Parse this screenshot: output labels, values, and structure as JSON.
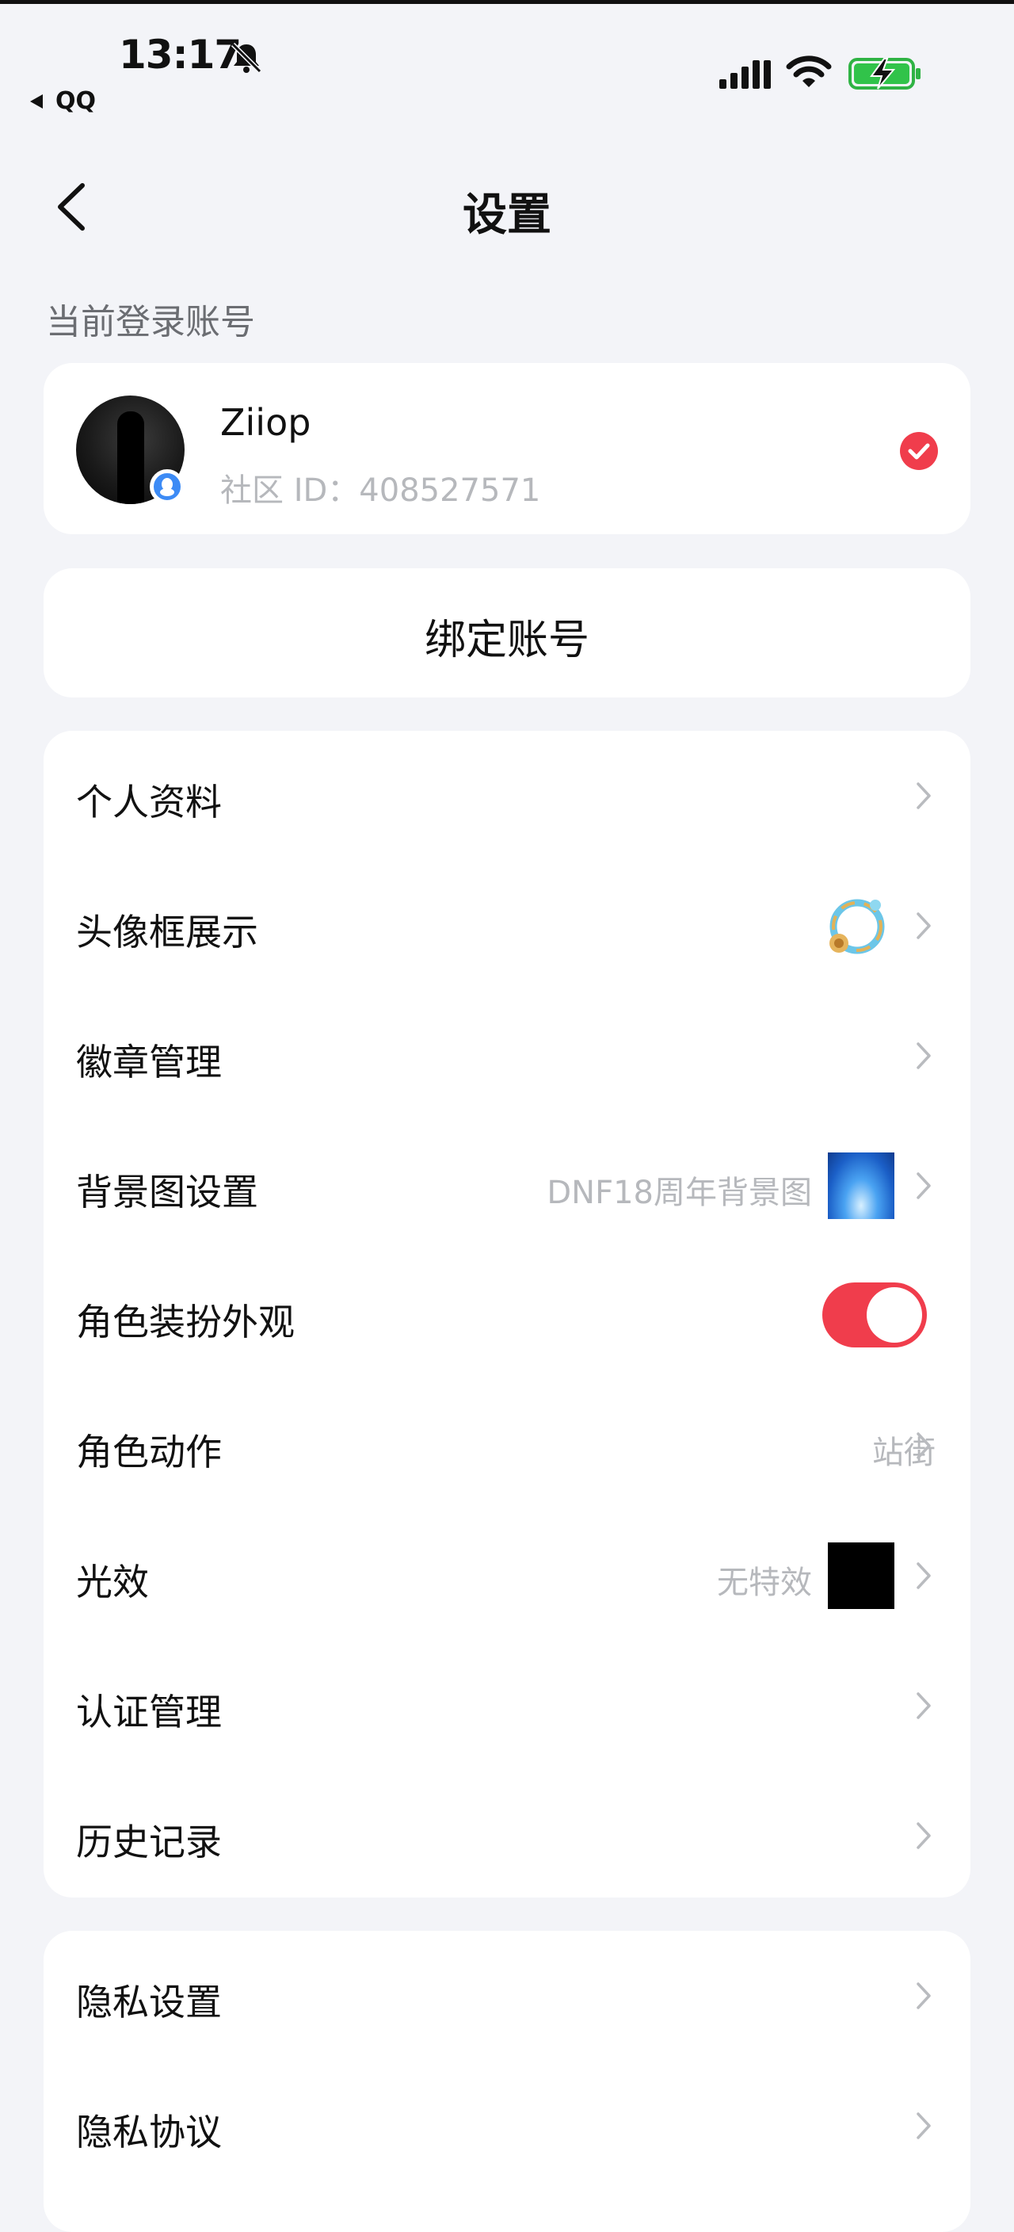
{
  "status_bar": {
    "time": "13:17",
    "back_app": "QQ",
    "icons": [
      "bell-slash-icon",
      "signal-icon",
      "wifi-icon",
      "battery-charging-icon"
    ]
  },
  "nav": {
    "title": "设置"
  },
  "account_section": {
    "label": "当前登录账号",
    "name": "Ziiop",
    "community_id": "社区 ID：408527571"
  },
  "bind_button": "绑定账号",
  "menu_group_1": [
    {
      "label": "个人资料"
    },
    {
      "label": "头像框展示"
    },
    {
      "label": "徽章管理"
    },
    {
      "label": "背景图设置",
      "value": "DNF18周年背景图"
    },
    {
      "label": "角色装扮外观",
      "toggle_on": true
    },
    {
      "label": "角色动作",
      "value": "站街"
    },
    {
      "label": "光效",
      "value": "无特效"
    },
    {
      "label": "认证管理"
    },
    {
      "label": "历史记录"
    }
  ],
  "menu_group_2": [
    {
      "label": "隐私设置"
    },
    {
      "label": "隐私协议"
    }
  ],
  "colors": {
    "background": "#f3f4f8",
    "accent_red": "#f03d4c",
    "muted_text": "#b6b8bc",
    "qq_blue": "#3d8bf5"
  }
}
